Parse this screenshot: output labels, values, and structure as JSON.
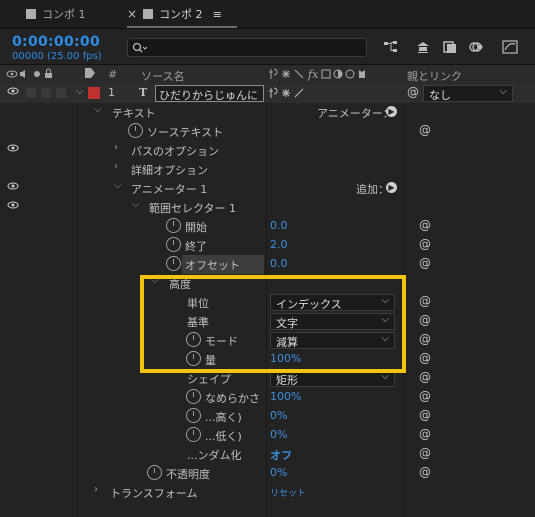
{
  "tabs": [
    {
      "label": "コンポ 1"
    },
    {
      "label": "コンポ 2"
    }
  ],
  "tab_close": "×",
  "tab_menu": "≡",
  "timecode": "0:00:00:00",
  "fps": "00000 (25.00 fps)",
  "search_placeholder": "",
  "columns": {
    "number": "#",
    "source_name": "ソース名",
    "parent": "親とリンク"
  },
  "layer": {
    "number": "1",
    "type_glyph": "T",
    "name": "ひだりからじゅんに",
    "parent_value": "なし"
  },
  "rows": {
    "text": "テキスト",
    "animator_menu": "アニメーター：",
    "source_text": "ソーステキスト",
    "path_options": "パスのオプション",
    "more_options": "詳細オプション",
    "animator1": "アニメーター 1",
    "add": "追加：",
    "range_selector": "範囲セレクター 1",
    "start": "開始",
    "start_val": "0.0",
    "end": "終了",
    "end_val": "2.0",
    "offset": "オフセット",
    "offset_val": "0.0",
    "advanced": "高度",
    "units": "単位",
    "units_val": "インデックス",
    "based_on": "基準",
    "based_on_val": "文字",
    "mode": "モード",
    "mode_val": "減算",
    "amount": "量",
    "amount_val": "100%",
    "shape": "シェイプ",
    "shape_val": "矩形",
    "smoothness": "なめらかさ",
    "smoothness_val": "100%",
    "ease_high": "...高く)",
    "ease_high_val": "0%",
    "ease_low": "...低く)",
    "ease_low_val": "0%",
    "randomize": "...ンダム化",
    "randomize_val": "オフ",
    "opacity": "不透明度",
    "opacity_val": "0%",
    "transform": "トランスフォーム",
    "reset": "リセット"
  },
  "colors": {
    "accent_blue": "#3d8fe0",
    "highlight_yellow": "#f1c40f",
    "label_red": "#c0302e"
  }
}
